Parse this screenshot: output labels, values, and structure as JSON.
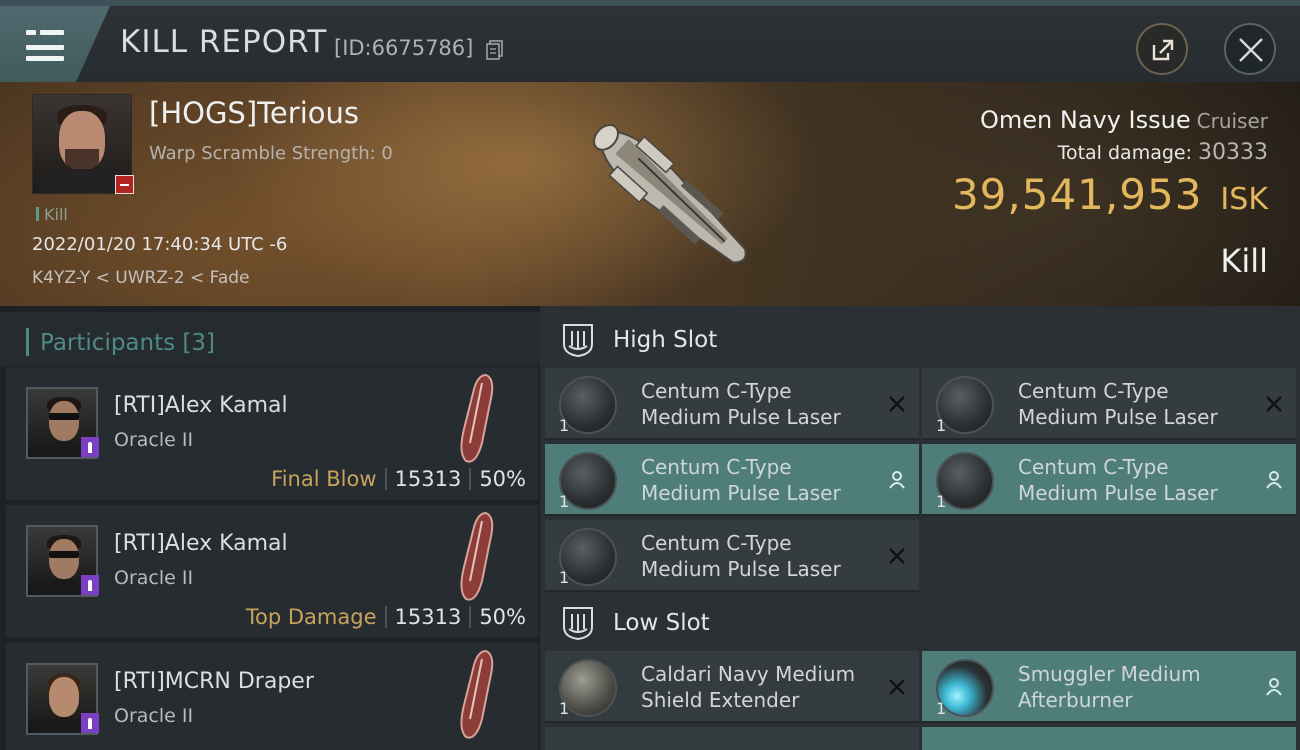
{
  "header": {
    "title": "KILL REPORT",
    "id_text": "[ID:6675786]"
  },
  "victim": {
    "name": "[HOGS]Terious",
    "subtitle": "Warp Scramble Strength: 0",
    "kill_tag": "Kill",
    "timestamp": "2022/01/20 17:40:34 UTC -6",
    "location": "K4YZ-Y < UWRZ-2 < Fade",
    "ship_name": "Omen Navy Issue",
    "ship_class": "Cruiser",
    "total_damage_label": "Total damage:",
    "total_damage": "30333",
    "isk_value": "39,541,953",
    "isk_unit": "ISK",
    "result": "Kill"
  },
  "participants": {
    "title": "Participants",
    "count": "[3]",
    "items": [
      {
        "name": "[RTI]Alex Kamal",
        "ship": "Oracle II",
        "tag": "Final Blow",
        "damage": "15313",
        "percent": "50%"
      },
      {
        "name": "[RTI]Alex Kamal",
        "ship": "Oracle II",
        "tag": "Top Damage",
        "damage": "15313",
        "percent": "50%"
      },
      {
        "name": "[RTI]MCRN Draper",
        "ship": "Oracle II",
        "tag": "",
        "damage": "",
        "percent": ""
      }
    ]
  },
  "fitting": {
    "high_slot_title": "High Slot",
    "low_slot_title": "Low Slot",
    "high": [
      {
        "line1": "Centum C-Type",
        "line2": "Medium Pulse Laser",
        "qty": "1",
        "state": "destroyed"
      },
      {
        "line1": "Centum C-Type",
        "line2": "Medium Pulse Laser",
        "qty": "1",
        "state": "destroyed"
      },
      {
        "line1": "Centum C-Type",
        "line2": "Medium Pulse Laser",
        "qty": "1",
        "state": "dropped"
      },
      {
        "line1": "Centum C-Type",
        "line2": "Medium Pulse Laser",
        "qty": "1",
        "state": "dropped"
      },
      {
        "line1": "Centum C-Type",
        "line2": "Medium Pulse Laser",
        "qty": "1",
        "state": "destroyed"
      }
    ],
    "low": [
      {
        "line1": "Caldari Navy Medium",
        "line2": "Shield Extender",
        "qty": "1",
        "state": "destroyed"
      },
      {
        "line1": "Smuggler Medium",
        "line2": "Afterburner",
        "qty": "1",
        "state": "dropped"
      }
    ]
  },
  "colors": {
    "accent_teal": "#4f8a85",
    "isk_gold": "#e3b75e",
    "dropped_bg": "#4e7d7a",
    "loss_red": "#b3231f",
    "pilot_purple": "#7b3fc4"
  },
  "icons": {
    "menu": "menu-icon",
    "copy": "copy-icon",
    "share": "share-icon",
    "close": "close-icon",
    "destroyed": "x-icon",
    "dropped": "person-icon",
    "slot": "slot-icon"
  }
}
